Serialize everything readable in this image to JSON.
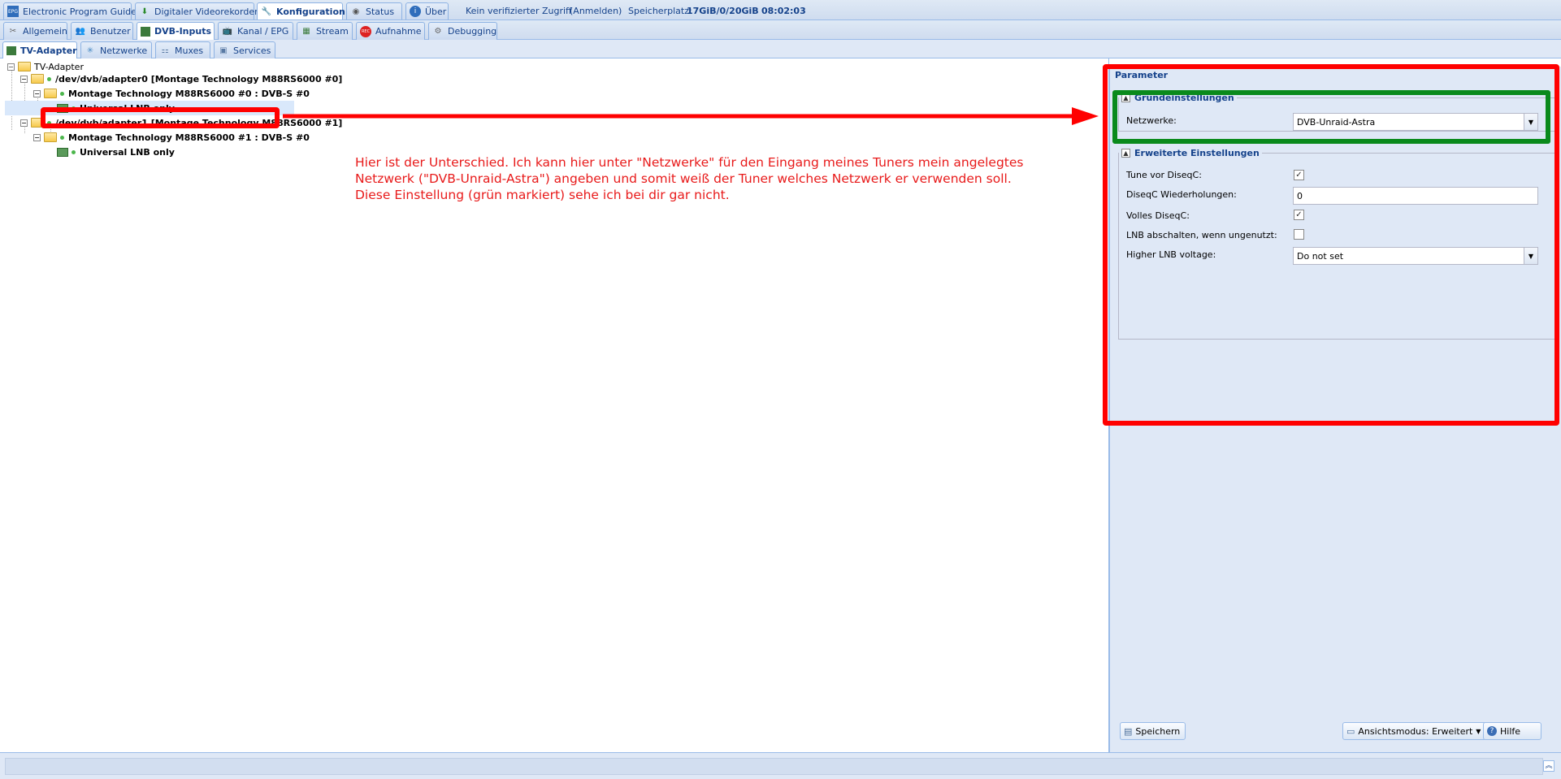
{
  "top_tabs": [
    {
      "label": "Electronic Program Guide",
      "icon": "epg-icon"
    },
    {
      "label": "Digitaler Videorekorder",
      "icon": "dvr-icon"
    },
    {
      "label": "Konfiguration",
      "icon": "wrench-icon"
    },
    {
      "label": "Status",
      "icon": "eye-icon"
    },
    {
      "label": "Über",
      "icon": "info-icon"
    }
  ],
  "top_info": {
    "access": "Kein verifizierter Zugriff",
    "login": "(Anmelden)",
    "storage_label": "Speicherplatz:",
    "storage_value": "17GiB/0/20GiB",
    "time": "08:02:03"
  },
  "config_tabs": [
    {
      "label": "Allgemein"
    },
    {
      "label": "Benutzer"
    },
    {
      "label": "DVB-Inputs"
    },
    {
      "label": "Kanal / EPG"
    },
    {
      "label": "Stream"
    },
    {
      "label": "Aufnahme"
    },
    {
      "label": "Debugging"
    }
  ],
  "dvb_tabs": [
    {
      "label": "TV-Adapter"
    },
    {
      "label": "Netzwerke"
    },
    {
      "label": "Muxes"
    },
    {
      "label": "Services"
    }
  ],
  "tree": {
    "root": "TV-Adapter",
    "adapter0": "/dev/dvb/adapter0 [Montage Technology M88RS6000 #0]",
    "frontend0": "Montage Technology M88RS6000 #0 : DVB-S #0",
    "lnb0": "Universal LNB only",
    "adapter1": "/dev/dvb/adapter1 [Montage Technology M88RS6000 #1]",
    "frontend1": "Montage Technology M88RS6000 #1 : DVB-S #0",
    "lnb1": "Universal LNB only"
  },
  "annotation": {
    "line1": "Hier ist der Unterschied. Ich kann hier unter \"Netzwerke\" für den Eingang meines Tuners mein angelegtes",
    "line2": "Netzwerk (\"DVB-Unraid-Astra\") angeben und somit weiß der Tuner welches Netzwerk er verwenden soll.",
    "line3": "Diese Einstellung (grün markiert) sehe ich bei dir gar nicht.",
    "red_color": "#ff0000",
    "green_color": "#0a8a1c"
  },
  "params": {
    "title": "Parameter",
    "basic_legend": "Grundeinstellungen",
    "networks_label": "Netzwerke:",
    "networks_value": "DVB-Unraid-Astra",
    "advanced_legend": "Erweiterte Einstellungen",
    "tune_label": "Tune vor DiseqC:",
    "tune_checked": true,
    "repeats_label": "DiseqC Wiederholungen:",
    "repeats_value": "0",
    "full_label": "Volles DiseqC:",
    "full_checked": true,
    "lnb_off_label": "LNB abschalten, wenn ungenutzt:",
    "lnb_off_checked": false,
    "voltage_label": "Higher LNB voltage:",
    "voltage_value": "Do not set"
  },
  "buttons": {
    "save": "Speichern",
    "view_mode": "Ansichtsmodus: Erweitert",
    "help": "Hilfe"
  }
}
